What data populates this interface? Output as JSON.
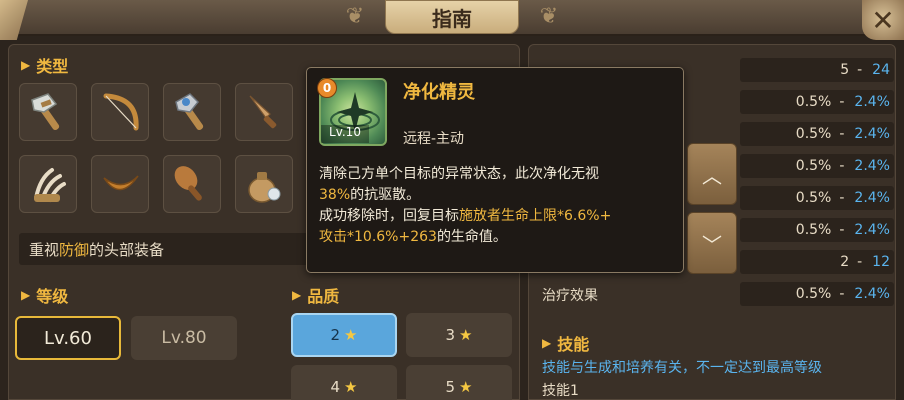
{
  "header": {
    "title": "指南"
  },
  "type_section": {
    "title": "类型",
    "items": [
      {
        "icon": "stone-hammer-icon"
      },
      {
        "icon": "bow-icon"
      },
      {
        "icon": "mace-icon"
      },
      {
        "icon": "dagger-icon"
      },
      {
        "icon": "claw-icon"
      },
      {
        "icon": "boomerang-icon"
      },
      {
        "icon": "club-icon"
      },
      {
        "icon": "bag-icon"
      }
    ],
    "hint_prefix": "重视",
    "hint_highlight": "防御",
    "hint_suffix": "的头部装备"
  },
  "level_section": {
    "title": "等级",
    "options": [
      "Lv.60",
      "Lv.80"
    ],
    "selected": "Lv.60"
  },
  "quality_section": {
    "title": "品质",
    "options": [
      "2",
      "3",
      "4",
      "5"
    ],
    "selected": "2"
  },
  "stats": [
    {
      "label": "",
      "min": "5",
      "max": "24"
    },
    {
      "label": "",
      "min": "0.5%",
      "max": "2.4%"
    },
    {
      "label": "",
      "min": "0.5%",
      "max": "2.4%"
    },
    {
      "label": "",
      "min": "0.5%",
      "max": "2.4%"
    },
    {
      "label": "",
      "min": "0.5%",
      "max": "2.4%"
    },
    {
      "label": "",
      "min": "0.5%",
      "max": "2.4%"
    },
    {
      "label": "",
      "min": "2",
      "max": "12"
    },
    {
      "label": "治疗效果",
      "min": "0.5%",
      "max": "2.4%"
    }
  ],
  "stat_separator": "-",
  "skills_section": {
    "title": "技能",
    "note": "技能与生成和培养有关，不一定达到最高等级",
    "first": "技能1"
  },
  "tooltip": {
    "badge": "0",
    "level": "Lv.10",
    "name": "净化精灵",
    "kind": "远程-主动",
    "line1": "清除己方单个目标的异常状态，此次净化无视",
    "line2_hl": "38%",
    "line2": "的抗驱散。",
    "line3": "成功移除时，回复目标",
    "line3_hl": "施放者生命上限*6.6%+",
    "line4_hl": "攻击*10.6%+263",
    "line4": "的生命值。"
  },
  "colors": {
    "accent": "#f0b840",
    "max_value": "#5ab4ee",
    "selected_quality": "#5aa6dc"
  }
}
